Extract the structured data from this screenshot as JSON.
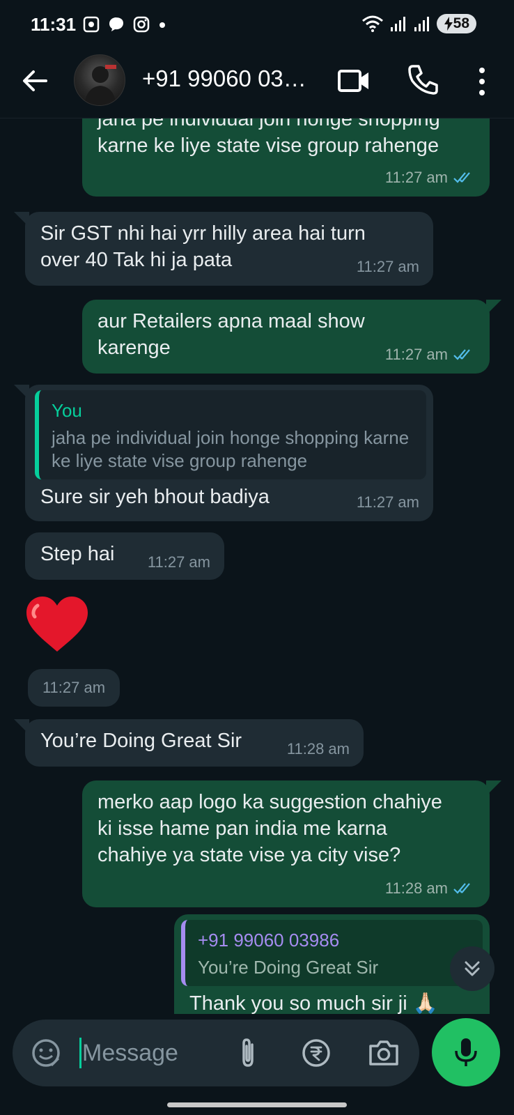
{
  "status_bar": {
    "time": "11:31",
    "battery": "58",
    "icons_left": [
      "screenshot-icon",
      "chat-bubble-icon",
      "instagram-icon",
      "dot-icon"
    ],
    "icons_right": [
      "wifi-icon",
      "signal-icon",
      "signal-icon",
      "battery-charging-icon"
    ]
  },
  "header": {
    "contact_name": "+91 99060 03…",
    "actions": [
      "video-call-icon",
      "phone-icon",
      "more-vert-icon"
    ]
  },
  "messages": [
    {
      "dir": "out",
      "text": "jaha pe individual join honge shopping karne ke liye state vise group rahenge",
      "time": "11:27 am",
      "status": "read"
    },
    {
      "dir": "in",
      "text": "Sir GST nhi hai yrr hilly area hai turn over 40 Tak hi ja pata",
      "time": "11:27 am"
    },
    {
      "dir": "out",
      "text": "aur Retailers apna maal show karenge",
      "time": "11:27 am",
      "status": "read"
    },
    {
      "dir": "in",
      "quote_author": "You",
      "quote_text": "jaha pe individual join honge shopping karne ke liye state vise group rahenge",
      "text": "Sure sir yeh bhout badiya",
      "time": "11:27 am"
    },
    {
      "dir": "in",
      "text": "Step hai",
      "time": "11:27 am"
    },
    {
      "dir": "in",
      "emoji": "❤️",
      "time": "11:27 am"
    },
    {
      "dir": "in",
      "text": "You’re Doing Great Sir",
      "time": "11:28 am"
    },
    {
      "dir": "out",
      "text": "merko aap logo ka suggestion chahiye ki isse hame pan india me karna chahiye ya state vise ya city vise?",
      "time": "11:28 am",
      "status": "read"
    },
    {
      "dir": "out",
      "quote_author": "+91 99060 03986",
      "quote_text": "You’re Doing Great Sir",
      "text": "Thank you so much sir ji 🙏🏻"
    }
  ],
  "input": {
    "placeholder": "Message"
  },
  "colors": {
    "background": "#0b141a",
    "outgoing_bubble": "#144d37",
    "incoming_bubble": "#1f2c34",
    "accent": "#21c063",
    "read_ticks": "#53bdeb"
  }
}
